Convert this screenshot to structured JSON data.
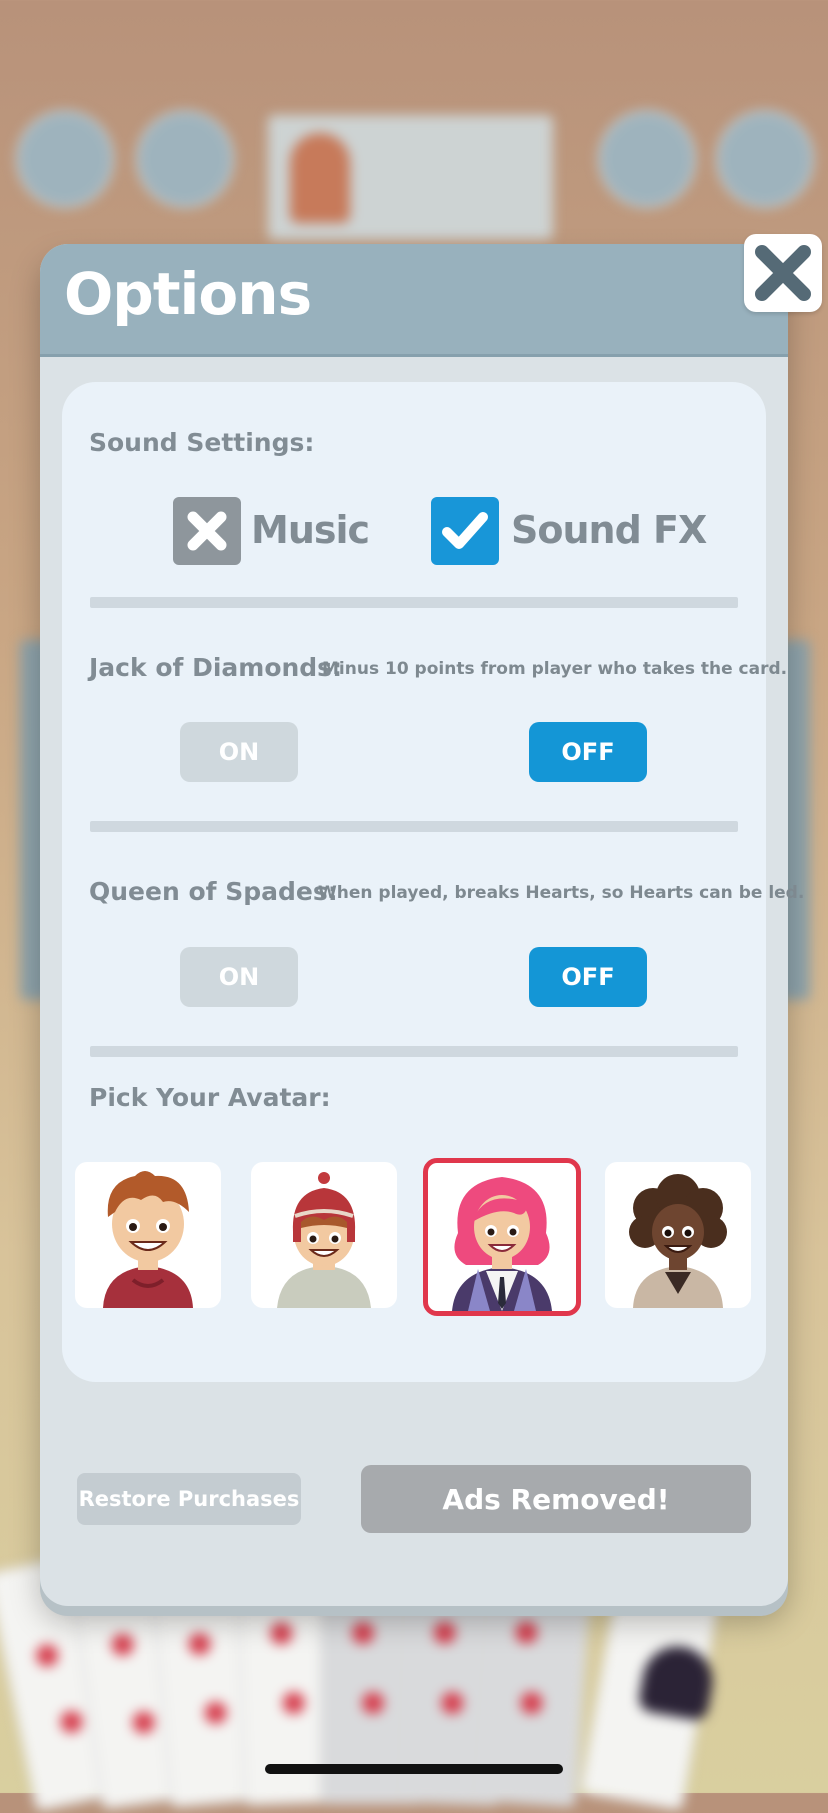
{
  "dialog": {
    "title": "Options",
    "close_icon": "close-x-icon"
  },
  "sound": {
    "label": "Sound Settings:",
    "music": {
      "label": "Music",
      "checked": false,
      "icon": "x-mark-icon"
    },
    "sound_fx": {
      "label": "Sound FX",
      "checked": true,
      "icon": "checkmark-icon"
    }
  },
  "jack_of_diamonds": {
    "label": "Jack of Diamonds:",
    "description": "Minus 10 points from player who takes the card.",
    "on_label": "ON",
    "off_label": "OFF",
    "selected": "OFF"
  },
  "queen_of_spades": {
    "label": "Queen of Spades:",
    "description": "When played, breaks Hearts, so Hearts can be led.",
    "on_label": "ON",
    "off_label": "OFF",
    "selected": "OFF"
  },
  "avatars": {
    "label": "Pick Your Avatar:",
    "items": [
      {
        "name": "avatar-boy-brown-hair",
        "selected": false
      },
      {
        "name": "avatar-boy-red-hat",
        "selected": false
      },
      {
        "name": "avatar-woman-pink-hair",
        "selected": true
      },
      {
        "name": "avatar-woman-curly-hair",
        "selected": false
      }
    ]
  },
  "footer": {
    "restore_label": "Restore Purchases",
    "ads_label": "Ads Removed!"
  },
  "colors": {
    "accent_blue": "#1496d6",
    "selected_border": "#e0374c",
    "header": "#98b1bd"
  }
}
